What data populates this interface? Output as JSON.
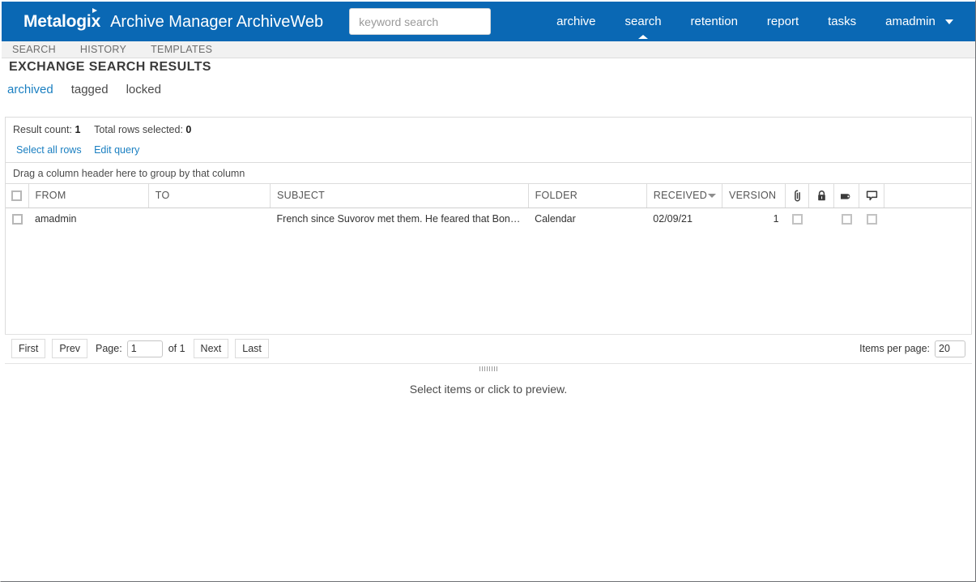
{
  "header": {
    "brand_logo": "Metalogix",
    "app_name": "Archive Manager ArchiveWeb",
    "search_placeholder": "keyword search",
    "search_value": "",
    "nav": [
      {
        "label": "archive",
        "active": false
      },
      {
        "label": "search",
        "active": true
      },
      {
        "label": "retention",
        "active": false
      },
      {
        "label": "report",
        "active": false
      },
      {
        "label": "tasks",
        "active": false
      }
    ],
    "user": "amadmin"
  },
  "subnav": {
    "items": [
      {
        "label": "SEARCH"
      },
      {
        "label": "HISTORY"
      },
      {
        "label": "TEMPLATES"
      }
    ]
  },
  "page": {
    "title": "EXCHANGE SEARCH RESULTS"
  },
  "filters": {
    "items": [
      {
        "label": "archived",
        "active": true
      },
      {
        "label": "tagged",
        "active": false
      },
      {
        "label": "locked",
        "active": false
      }
    ]
  },
  "results": {
    "result_count_label": "Result count:",
    "result_count_value": "1",
    "total_selected_label": "Total rows selected:",
    "total_selected_value": "0",
    "select_all_link": "Select all rows",
    "edit_query_link": "Edit query"
  },
  "grid": {
    "group_hint": "Drag a column header here to group by that column",
    "columns": [
      {
        "key": "check",
        "label": "",
        "type": "checkbox"
      },
      {
        "key": "from",
        "label": "FROM",
        "type": "text"
      },
      {
        "key": "to",
        "label": "TO",
        "type": "text"
      },
      {
        "key": "subject",
        "label": "SUBJECT",
        "type": "text"
      },
      {
        "key": "folder",
        "label": "FOLDER",
        "type": "text"
      },
      {
        "key": "received",
        "label": "RECEIVED",
        "type": "text",
        "sorted": true
      },
      {
        "key": "version",
        "label": "VERSION",
        "type": "number"
      },
      {
        "key": "attachment",
        "label": "",
        "type": "icon",
        "icon": "paperclip-icon"
      },
      {
        "key": "locked",
        "label": "",
        "type": "icon",
        "icon": "lock-icon"
      },
      {
        "key": "tag",
        "label": "",
        "type": "icon",
        "icon": "tag-icon"
      },
      {
        "key": "comment",
        "label": "",
        "type": "icon",
        "icon": "comment-icon"
      },
      {
        "key": "spacer",
        "label": "",
        "type": "text"
      }
    ],
    "rows": [
      {
        "check": false,
        "from": "amadmin",
        "to": "",
        "subject": "French since Suvorov met them. He feared that Bonapart...",
        "folder": "Calendar",
        "received": "02/09/21",
        "version": "1",
        "attachment_box": true,
        "locked_box": false,
        "tag_box": true,
        "comment_box": true
      }
    ]
  },
  "pager": {
    "first": "First",
    "prev": "Prev",
    "page_label": "Page:",
    "page_value": "1",
    "of_label": "of 1",
    "next": "Next",
    "last": "Last",
    "items_per_page_label": "Items per page:",
    "items_per_page_value": "20"
  },
  "preview": {
    "message": "Select items or click to preview."
  },
  "colors": {
    "brand_blue": "#0a68b4",
    "link_blue": "#1a7fc1",
    "border_gray": "#dcdcdc",
    "subnav_bg": "#f1f1f1"
  }
}
